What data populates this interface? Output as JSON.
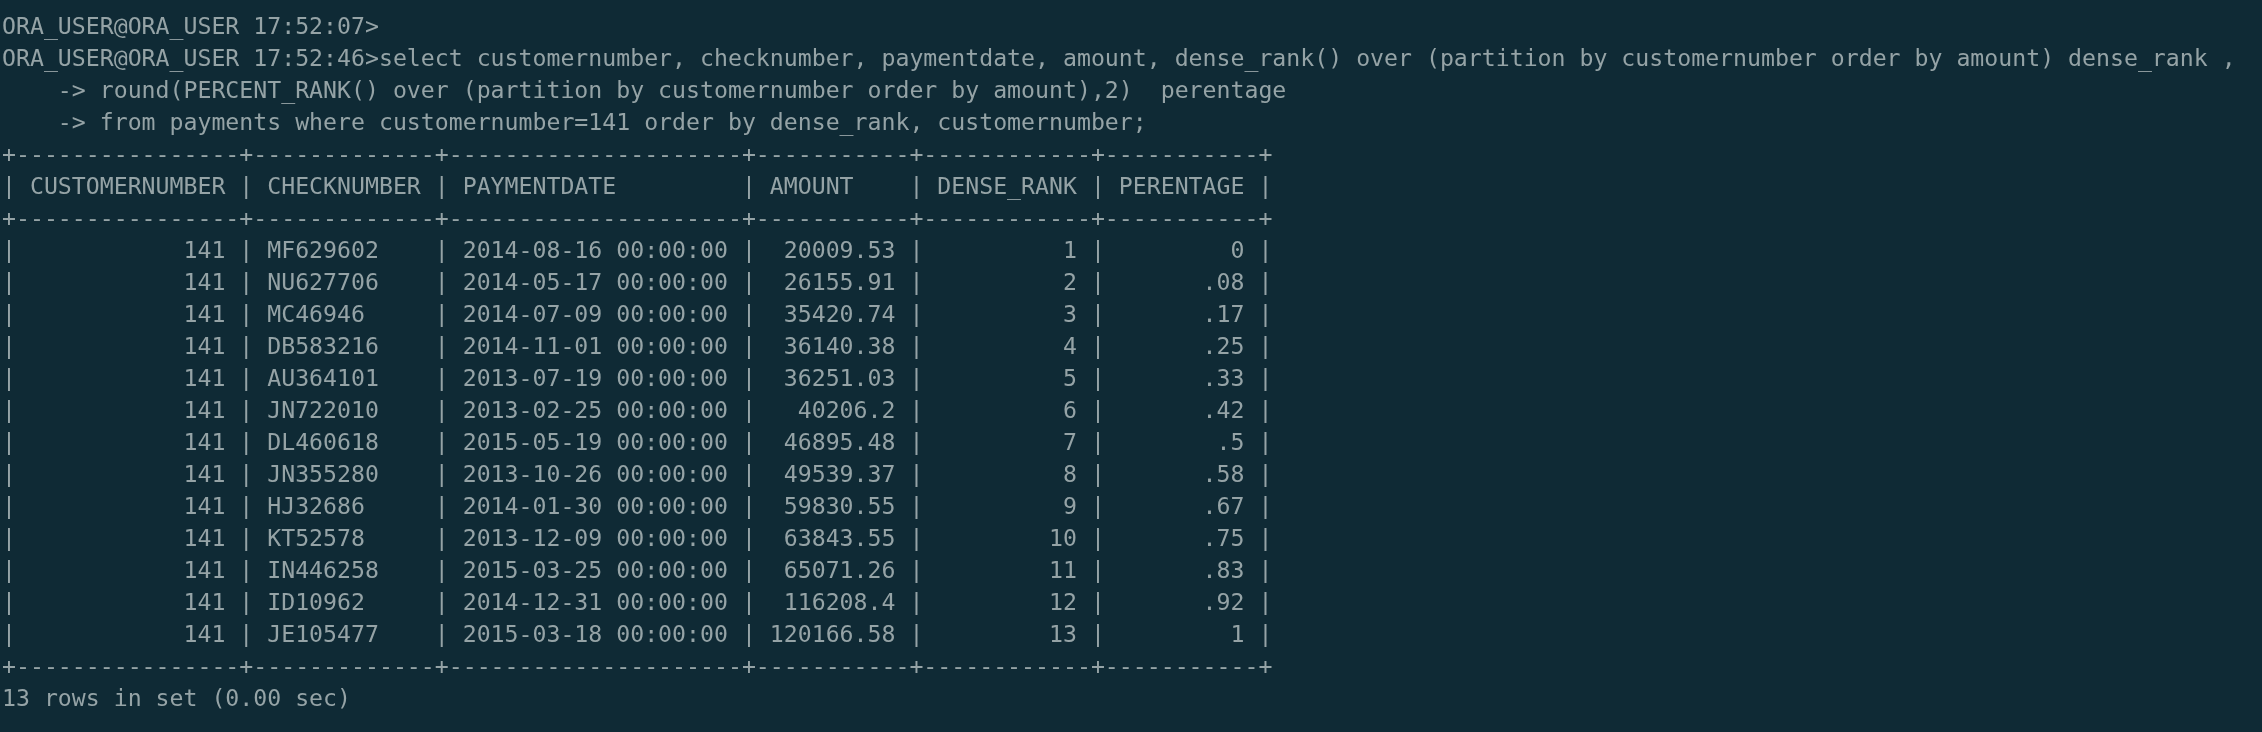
{
  "terminal": {
    "lines": [
      "ORA_USER@ORA_USER 17:52:07>",
      "ORA_USER@ORA_USER 17:52:46>select customernumber, checknumber, paymentdate, amount, dense_rank() over (partition by customernumber order by amount) dense_rank ,",
      "    -> round(PERCENT_RANK() over (partition by customernumber order by amount),2)  perentage",
      "    -> from payments where customernumber=141 order by dense_rank, customernumber;",
      "+----------------+-------------+---------------------+-----------+------------+-----------+",
      "| CUSTOMERNUMBER | CHECKNUMBER | PAYMENTDATE         | AMOUNT    | DENSE_RANK | PERENTAGE |",
      "+----------------+-------------+---------------------+-----------+------------+-----------+",
      "|            141 | MF629602    | 2014-08-16 00:00:00 |  20009.53 |          1 |         0 |",
      "|            141 | NU627706    | 2014-05-17 00:00:00 |  26155.91 |          2 |       .08 |",
      "|            141 | MC46946     | 2014-07-09 00:00:00 |  35420.74 |          3 |       .17 |",
      "|            141 | DB583216    | 2014-11-01 00:00:00 |  36140.38 |          4 |       .25 |",
      "|            141 | AU364101    | 2013-07-19 00:00:00 |  36251.03 |          5 |       .33 |",
      "|            141 | JN722010    | 2013-02-25 00:00:00 |   40206.2 |          6 |       .42 |",
      "|            141 | DL460618    | 2015-05-19 00:00:00 |  46895.48 |          7 |        .5 |",
      "|            141 | JN355280    | 2013-10-26 00:00:00 |  49539.37 |          8 |       .58 |",
      "|            141 | HJ32686     | 2014-01-30 00:00:00 |  59830.55 |          9 |       .67 |",
      "|            141 | KT52578     | 2013-12-09 00:00:00 |  63843.55 |         10 |       .75 |",
      "|            141 | IN446258    | 2015-03-25 00:00:00 |  65071.26 |         11 |       .83 |",
      "|            141 | ID10962     | 2014-12-31 00:00:00 |  116208.4 |         12 |       .92 |",
      "|            141 | JE105477    | 2015-03-18 00:00:00 | 120166.58 |         13 |         1 |",
      "+----------------+-------------+---------------------+-----------+------------+-----------+",
      "13 rows in set (0.00 sec)"
    ]
  }
}
